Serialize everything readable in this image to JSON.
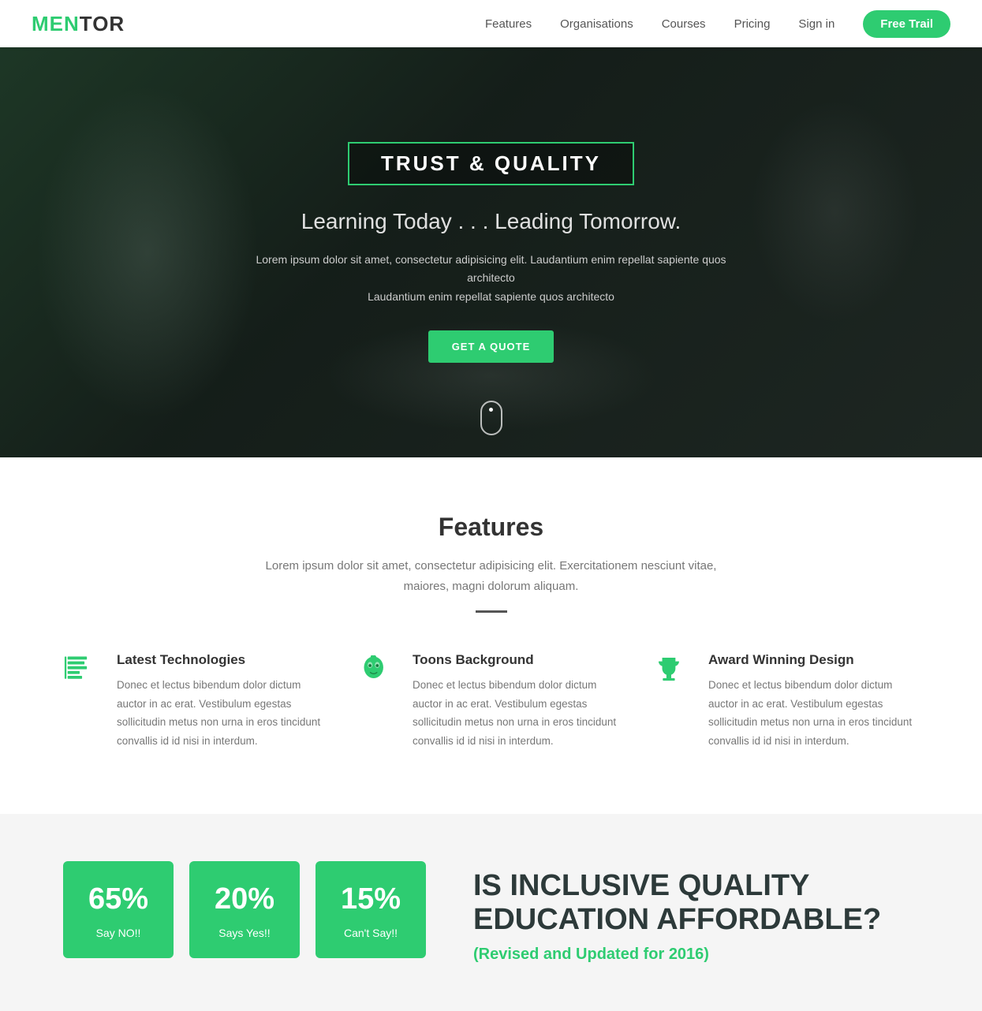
{
  "navbar": {
    "logo_men": "MEN",
    "logo_tor": "TOR",
    "links": [
      {
        "label": "Features",
        "href": "#"
      },
      {
        "label": "Organisations",
        "href": "#"
      },
      {
        "label": "Courses",
        "href": "#"
      },
      {
        "label": "Pricing",
        "href": "#"
      },
      {
        "label": "Sign in",
        "href": "#"
      }
    ],
    "cta_label": "Free Trail"
  },
  "hero": {
    "badge": "TRUST & QUALITY",
    "subtitle": "Learning Today . . . Leading Tomorrow.",
    "desc_line1": "Lorem ipsum dolor sit amet, consectetur adipisicing elit. Laudantium enim repellat sapiente quos architecto",
    "desc_line2": "Laudantium enim repellat sapiente quos architecto",
    "cta_label": "GET A QUOTE"
  },
  "features": {
    "title": "Features",
    "subtitle": "Lorem ipsum dolor sit amet, consectetur adipisicing elit. Exercitationem nesciunt vitae, maiores, magni dolorum aliquam.",
    "items": [
      {
        "icon": "css3",
        "title": "Latest Technologies",
        "desc": "Donec et lectus bibendum dolor dictum auctor in ac erat. Vestibulum egestas sollicitudin metus non urna in eros tincidunt convallis id id nisi in interdum."
      },
      {
        "icon": "alien",
        "title": "Toons Background",
        "desc": "Donec et lectus bibendum dolor dictum auctor in ac erat. Vestibulum egestas sollicitudin metus non urna in eros tincidunt convallis id id nisi in interdum."
      },
      {
        "icon": "trophy",
        "title": "Award Winning Design",
        "desc": "Donec et lectus bibendum dolor dictum auctor in ac erat. Vestibulum egestas sollicitudin metus non urna in eros tincidunt convallis id id nisi in interdum."
      }
    ]
  },
  "stats": {
    "cards": [
      {
        "percent": "65%",
        "label": "Say NO!!"
      },
      {
        "percent": "20%",
        "label": "Says Yes!!"
      },
      {
        "percent": "15%",
        "label": "Can't Say!!"
      }
    ],
    "heading_line1": "IS INCLUSIVE QUALITY",
    "heading_line2": "EDUCATION AFFORDABLE?",
    "highlight": "(Revised and Updated for 2016)"
  }
}
